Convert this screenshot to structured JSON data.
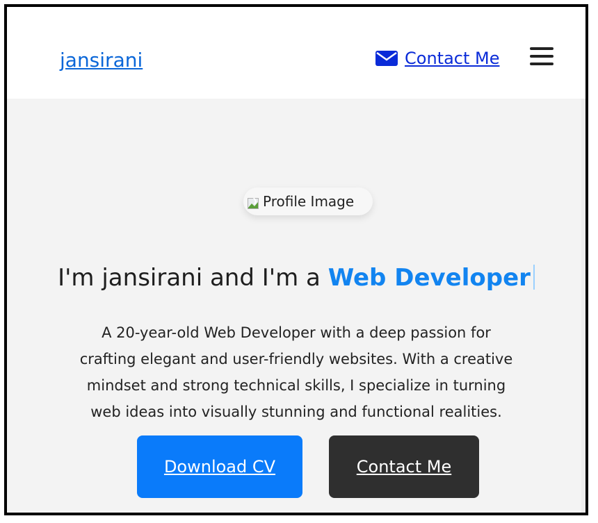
{
  "header": {
    "brand": "jansirani",
    "contact_label": "Contact Me"
  },
  "hero": {
    "profile_alt": "Profile Image",
    "headline_prefix": "I'm jansirani and I'm a ",
    "headline_accent": "Web Developer",
    "description": "A 20-year-old Web Developer with a deep passion for crafting elegant and user-friendly websites. With a creative mindset and strong technical skills, I specialize in turning web ideas into visually stunning and functional realities.",
    "buttons": {
      "download": "Download CV",
      "contact": "Contact Me"
    }
  },
  "colors": {
    "accent": "#1284f0",
    "primary_button": "#0a7bfa",
    "secondary_button": "#2f2f2f",
    "brand_link": "#0a66d8"
  },
  "icons": {
    "mail": "envelope-icon",
    "menu": "hamburger-menu-icon",
    "broken_image": "broken-image-icon"
  }
}
